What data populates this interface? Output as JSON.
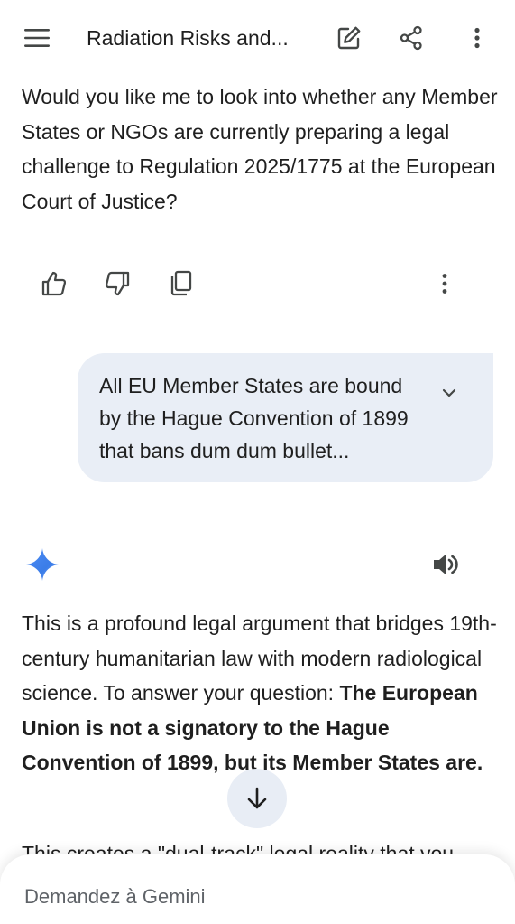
{
  "header": {
    "title": "Radiation Risks and...",
    "icons": {
      "menu": "menu-icon",
      "edit": "edit-icon",
      "share": "share-icon",
      "more": "more-vert-icon"
    }
  },
  "messages": {
    "assistant_question": "Would you like me to look into whether any Member States or NGOs are currently preparing a legal challenge to Regulation 2025/1775 at the European Court of Justice?",
    "user_prompt": "All EU Member States are bound by the Hague Convention of 1899 that bans dum dum bullet...",
    "response": {
      "intro": "This is a profound legal argument that bridges 19th-century humanitarian law with modern radiological science. To answer your question: ",
      "bold": "The European Union is not a signatory to the Hague Convention of 1899, but its Member States are.",
      "next_line": "This creates a \"dual-track\" legal reality that you"
    }
  },
  "actions": {
    "icons": [
      "thumb-up-icon",
      "thumb-down-icon",
      "copy-icon",
      "more-vert-icon"
    ]
  },
  "input": {
    "placeholder": "Demandez à Gemini",
    "value": ""
  },
  "colors": {
    "bubble": "#e9eef6",
    "gemini_blue": "#4285f4",
    "text": "#1f1f1f"
  }
}
